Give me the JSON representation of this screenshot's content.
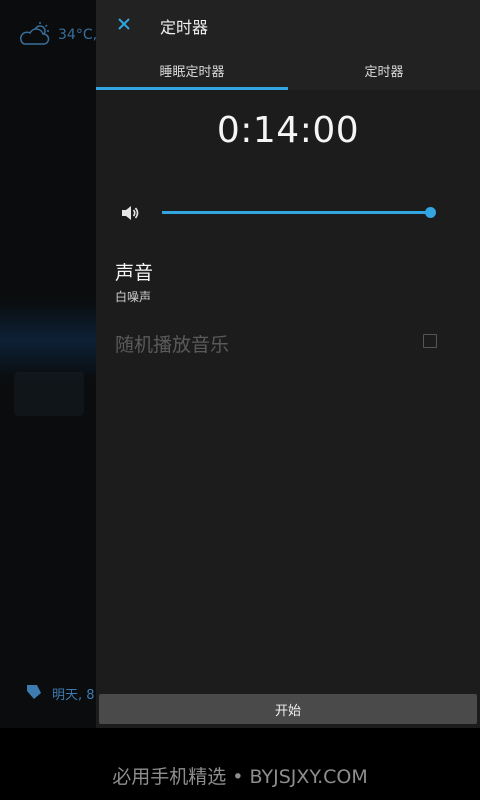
{
  "background": {
    "weather_text": "34°C,",
    "alarm_text": "明天, 8:"
  },
  "drawer": {
    "title": "定时器",
    "tabs": [
      {
        "label": "睡眠定时器",
        "active": true
      },
      {
        "label": "定时器",
        "active": false
      }
    ],
    "timer_value": "0:14:00",
    "volume_level": 1.0,
    "sound_pref": {
      "title": "声音",
      "summary": "白噪声"
    },
    "shuffle_pref": {
      "title": "随机播放音乐",
      "checked": false
    },
    "start_button": "开始"
  },
  "colors": {
    "accent": "#33a5e0",
    "drawer_bg": "#1c1c1c",
    "header_bg": "#222222"
  },
  "watermark": "必用手机精选 • BYJSJXY.COM"
}
